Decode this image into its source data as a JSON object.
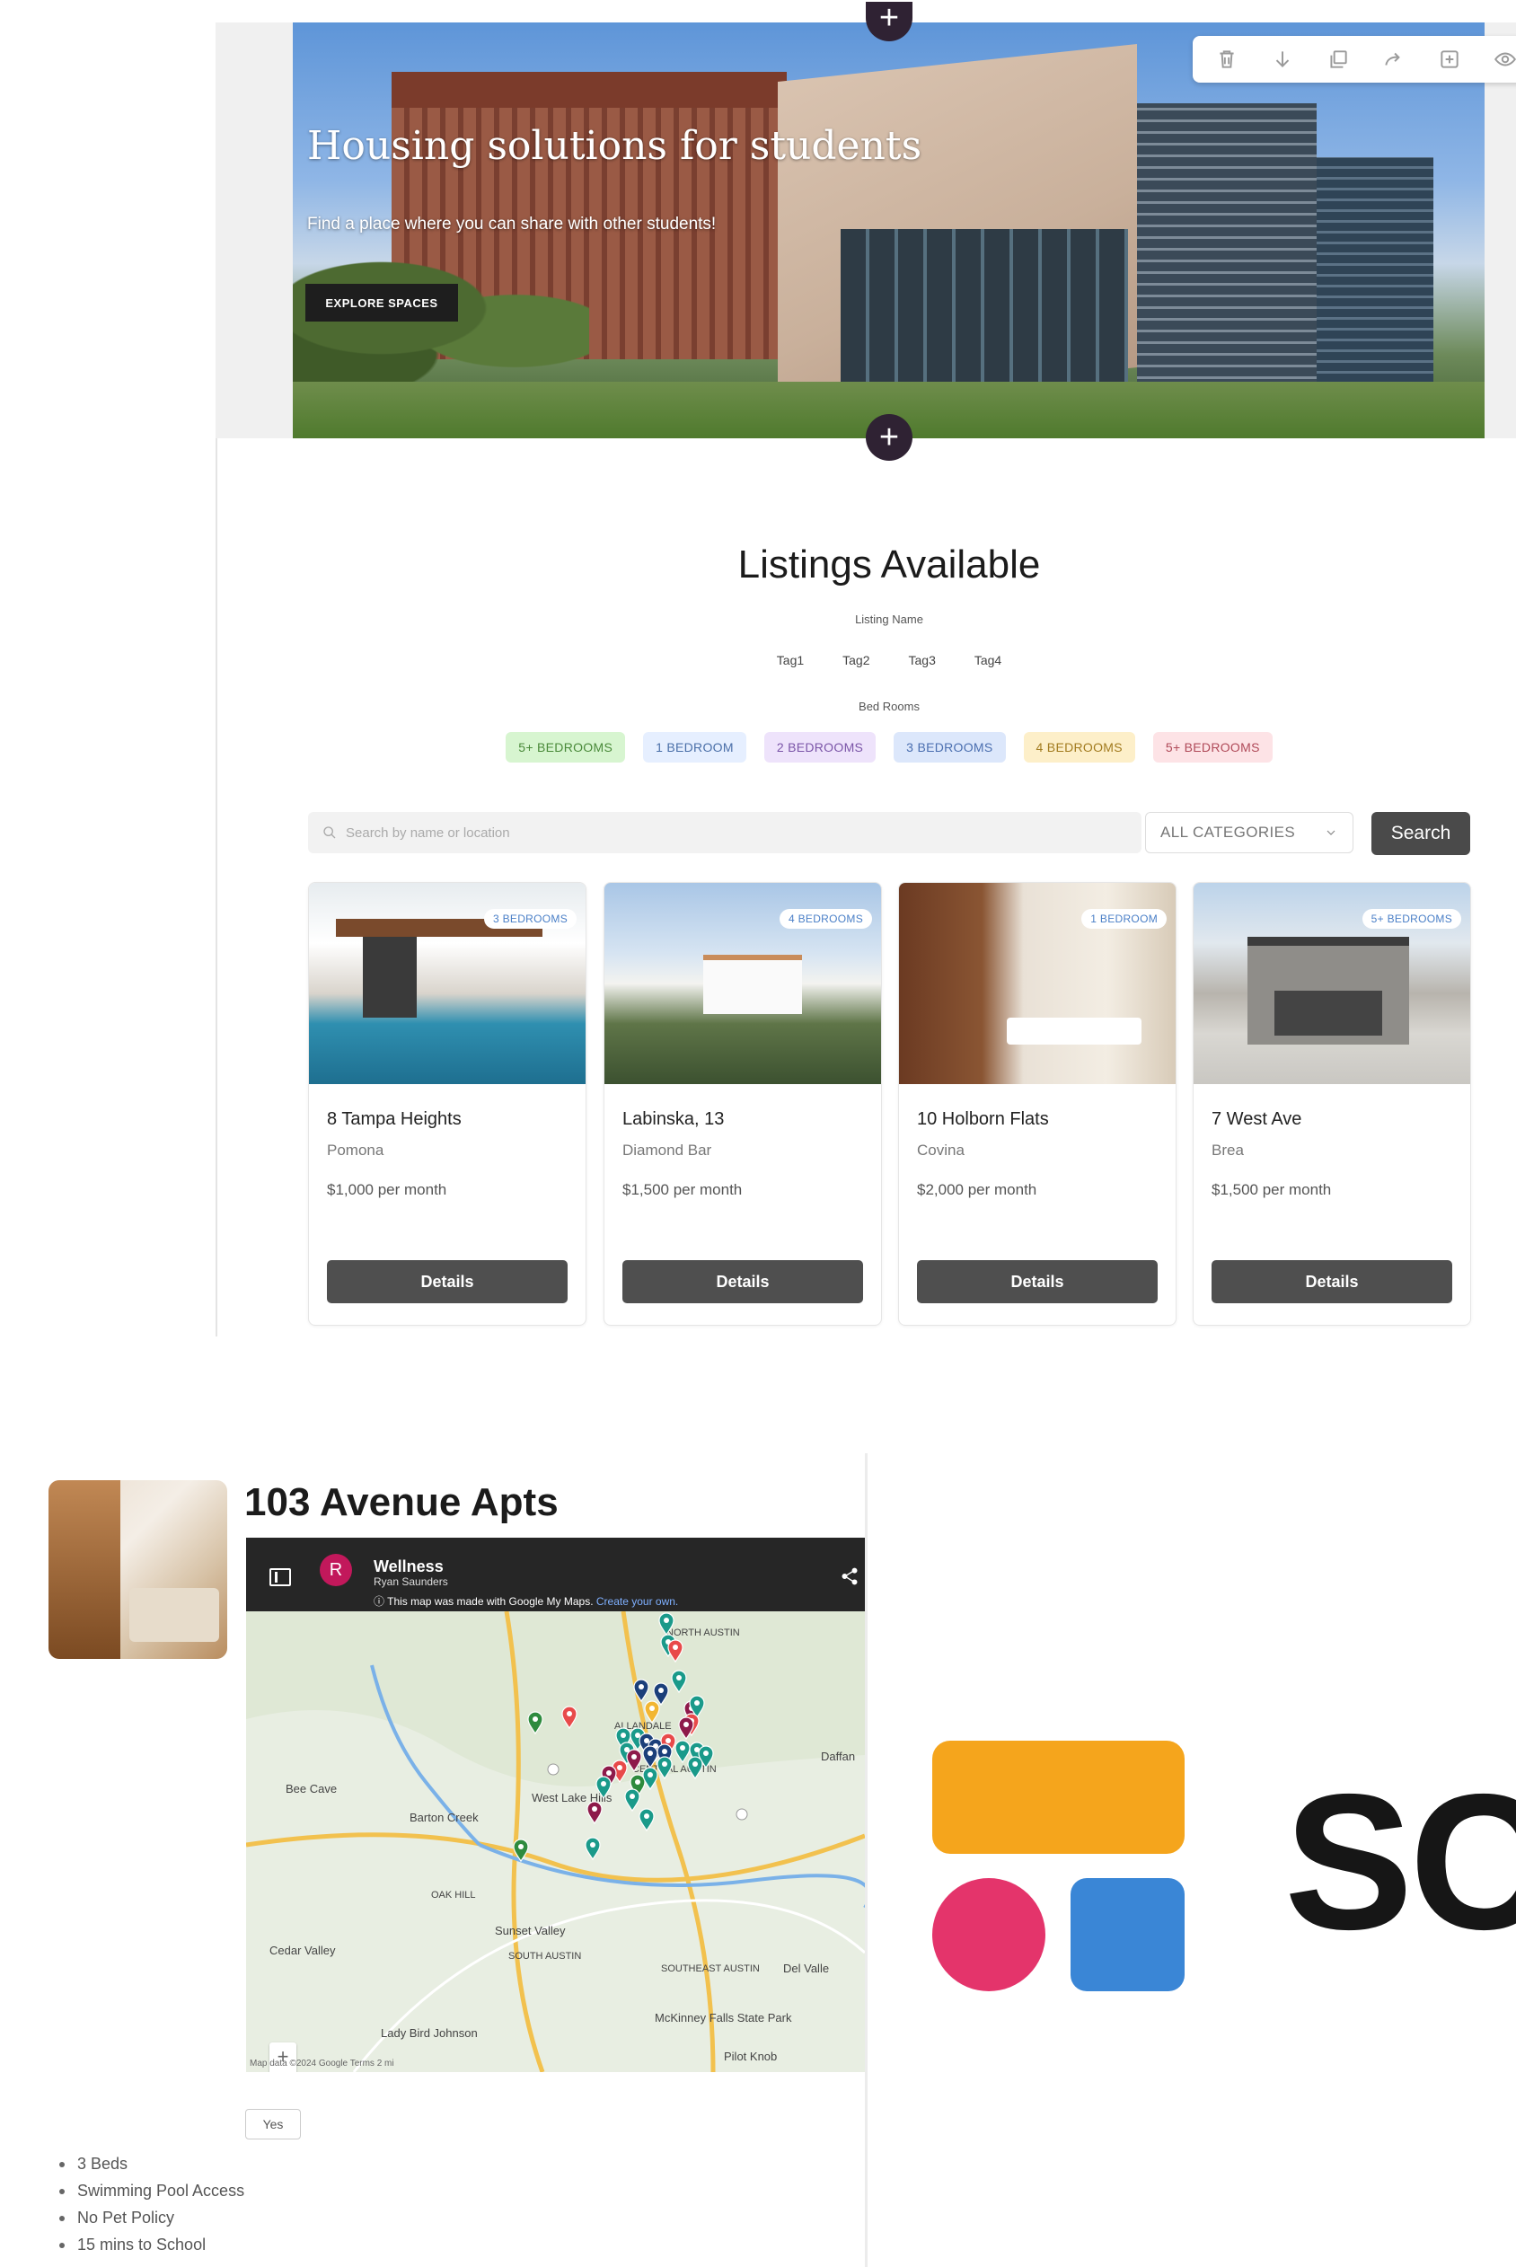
{
  "hero": {
    "title": "Housing solutions for students",
    "subtitle": "Find a place where you can share with other students!",
    "cta_label": "EXPLORE SPACES"
  },
  "editor_toolbar": {
    "icons": [
      "trash-icon",
      "arrow-down-icon",
      "duplicate-icon",
      "redo-icon",
      "add-block-icon",
      "eye-icon"
    ]
  },
  "listings": {
    "title": "Listings Available",
    "listing_name_label": "Listing Name",
    "tags": [
      "Tag1",
      "Tag2",
      "Tag3",
      "Tag4"
    ],
    "bedrooms_label": "Bed Rooms",
    "bedroom_chips": [
      {
        "label": "5+ BEDROOMS",
        "bg": "#d7f5d0",
        "fg": "#4a8a3a"
      },
      {
        "label": "1 BEDROOM",
        "bg": "#e6efff",
        "fg": "#4a6fa8"
      },
      {
        "label": "2 BEDROOMS",
        "bg": "#eee3fb",
        "fg": "#7b55a8"
      },
      {
        "label": "3 BEDROOMS",
        "bg": "#dce7fb",
        "fg": "#4b6fb0"
      },
      {
        "label": "4 BEDROOMS",
        "bg": "#fdefc9",
        "fg": "#a27b1f"
      },
      {
        "label": "5+ BEDROOMS",
        "bg": "#fde3e6",
        "fg": "#b04a59"
      }
    ],
    "search_placeholder": "Search by name or location",
    "category_select": "ALL CATEGORIES",
    "search_button": "Search",
    "cards": [
      {
        "badge": "3 BEDROOMS",
        "title": "8 Tampa Heights",
        "city": "Pomona",
        "price": "$1,000 per month",
        "button": "Details"
      },
      {
        "badge": "4 BEDROOMS",
        "title": "Labinska, 13",
        "city": "Diamond Bar",
        "price": "$1,500 per month",
        "button": "Details"
      },
      {
        "badge": "1 BEDROOM",
        "title": "10 Holborn Flats",
        "city": "Covina",
        "price": "$2,000 per month",
        "button": "Details"
      },
      {
        "badge": "5+ BEDROOMS",
        "title": "7 West Ave",
        "city": "Brea",
        "price": "$1,500 per month",
        "button": "Details"
      }
    ]
  },
  "detail": {
    "title": "103 Avenue Apts",
    "map": {
      "map_name": "Wellness",
      "owner": "Ryan Saunders",
      "note": "This map was made with Google My Maps.",
      "note_link": "Create your own.",
      "avatar_letter": "R",
      "footer": "Map data ©2024 Google   Terms   2 mi",
      "place_labels": [
        "Bee Cave",
        "Barton Creek",
        "West Lake Hills",
        "Cedar Valley",
        "Sunset Valley",
        "Lady Bird Johnson",
        "McKinney Falls State Park",
        "Del Valle",
        "Daffan",
        "ALLANDALE",
        "SOUTH AUSTIN",
        "SOUTHEAST AUSTIN",
        "OAK HILL",
        "Pilot Knob",
        "NORTH AUSTIN",
        "CENTRAL AUSTIN"
      ],
      "pin_colors": {
        "teal": "#1a9a8a",
        "navy": "#1b3f7a",
        "red": "#e84a4a",
        "maroon": "#8e1a4a",
        "green": "#2e8b3e",
        "yellow": "#f2b632"
      }
    },
    "yes_button": "Yes",
    "features": [
      "3 Beds",
      "Swimming Pool Access",
      "No Pet Policy",
      "15 mins to School"
    ]
  },
  "brand": {
    "wordmark": "SC",
    "colors": {
      "yellow": "#f5a51c",
      "pink": "#e4346b",
      "blue": "#3a86d6"
    }
  }
}
